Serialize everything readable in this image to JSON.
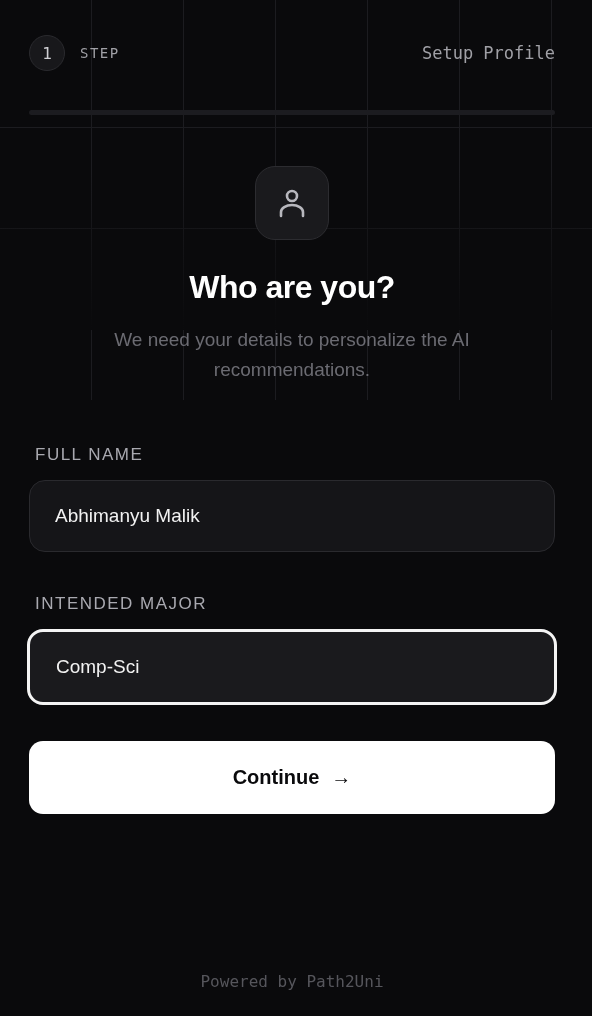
{
  "header": {
    "step_number": "1",
    "step_label": "STEP",
    "section": "Setup Profile"
  },
  "heading": {
    "title": "Who are you?",
    "subtitle": "We need your details to personalize the AI recommendations."
  },
  "fields": [
    {
      "label": "FULL NAME",
      "value": "Abhimanyu Malik",
      "focused": false
    },
    {
      "label": "INTENDED MAJOR",
      "value": "Comp-Sci",
      "focused": true
    }
  ],
  "primary_button": {
    "label": "Continue",
    "icon": "→"
  },
  "footer": "Powered by Path2Uni"
}
